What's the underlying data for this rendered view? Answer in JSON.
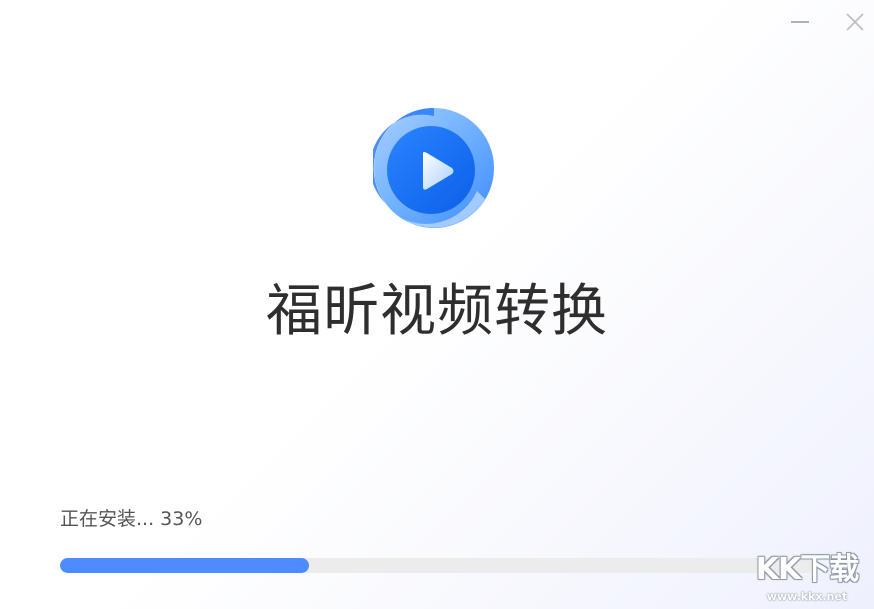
{
  "window": {
    "controls": {
      "minimize_icon": "minimize-icon",
      "close_icon": "close-icon"
    }
  },
  "app": {
    "logo_icon": "play-icon",
    "name": "福昕视频转换",
    "colors": {
      "logo_primary": "#1a6ff2",
      "logo_light": "#8cc0ff",
      "progress_fill": "#4d8cff",
      "progress_track": "#ececec"
    }
  },
  "install": {
    "status_text": "正在安装... 33%",
    "progress_percent": 33
  },
  "watermark": {
    "title": "KK下载",
    "url": "www.kkx.net"
  }
}
